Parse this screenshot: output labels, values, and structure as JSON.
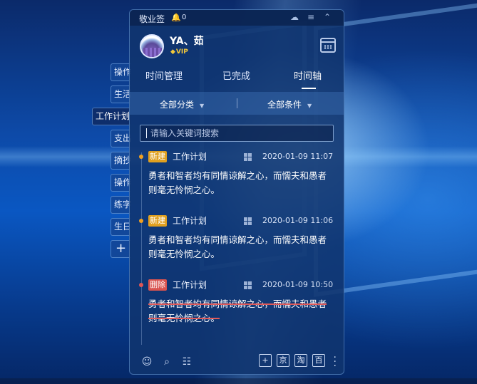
{
  "app": {
    "title": "敬业签",
    "notification_count": "0"
  },
  "user": {
    "name": "YA、茹",
    "badge": "VIP"
  },
  "side_tabs": [
    {
      "label": "操作"
    },
    {
      "label": "生活"
    },
    {
      "label": "工作计划"
    },
    {
      "label": "支出"
    },
    {
      "label": "摘抄"
    },
    {
      "label": "操作"
    },
    {
      "label": "练字"
    },
    {
      "label": "生日"
    },
    {
      "label": "+"
    }
  ],
  "tabs": [
    {
      "label": "时间管理"
    },
    {
      "label": "已完成"
    },
    {
      "label": "时间轴"
    }
  ],
  "filters": {
    "category": "全部分类",
    "condition": "全部条件"
  },
  "search": {
    "placeholder": "请输入关键词搜索"
  },
  "entries": [
    {
      "badge": "新建",
      "badge_color": "#e0a020",
      "dot_color": "#f0a020",
      "category": "工作计划",
      "timestamp": "2020-01-09 11:07",
      "content": "勇者和智者均有同情谅解之心，而懦夫和愚者则毫无怜悯之心。",
      "status": "new"
    },
    {
      "badge": "新建",
      "badge_color": "#e0a020",
      "dot_color": "#f0a020",
      "category": "工作计划",
      "timestamp": "2020-01-09 11:06",
      "content": "勇者和智者均有同情谅解之心，而懦夫和愚者则毫无怜悯之心。",
      "status": "new"
    },
    {
      "badge": "删除",
      "badge_color": "#d9534f",
      "dot_color": "#e05555",
      "category": "工作计划",
      "timestamp": "2020-01-09 10:50",
      "content": "勇者和智者均有同情谅解之心，而懦夫和愚者则毫无怜悯之心。",
      "status": "deleted"
    }
  ],
  "bottom_bar": {
    "left_icons": [
      "contacts-icon",
      "search-icon",
      "notes-icon"
    ],
    "buttons": [
      {
        "label": "+"
      },
      {
        "label": "京"
      },
      {
        "label": "淘"
      },
      {
        "label": "百"
      }
    ]
  },
  "colors": {
    "accent": "#ffffff",
    "panel": "#10346e",
    "new_badge": "#e0a020",
    "deleted_badge": "#d9534f"
  }
}
